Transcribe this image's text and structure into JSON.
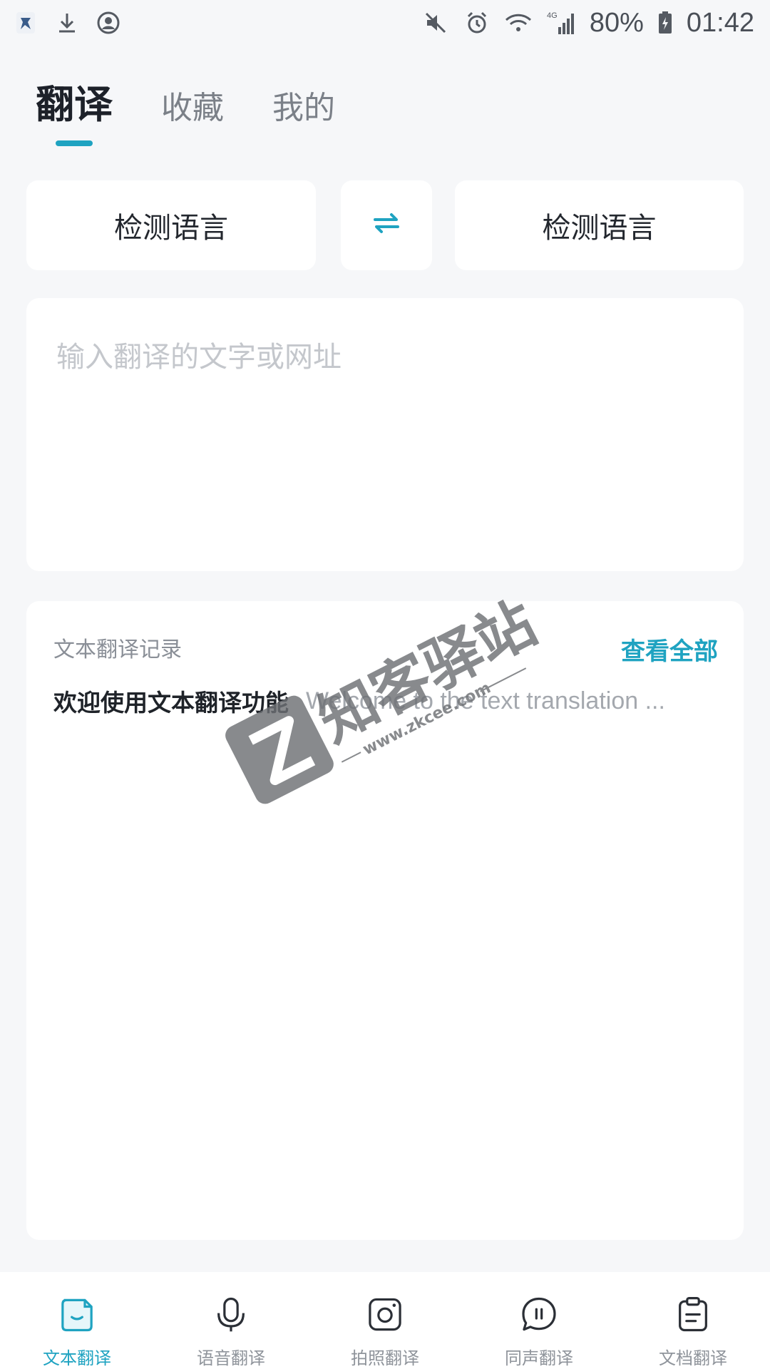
{
  "status_bar": {
    "battery": "80%",
    "time": "01:42",
    "network": "4G"
  },
  "tabs": [
    {
      "label": "翻译",
      "active": true
    },
    {
      "label": "收藏",
      "active": false
    },
    {
      "label": "我的",
      "active": false
    }
  ],
  "languages": {
    "source": "检测语言",
    "target": "检测语言"
  },
  "input": {
    "placeholder": "输入翻译的文字或网址",
    "value": ""
  },
  "history": {
    "title": "文本翻译记录",
    "view_all": "查看全部",
    "items": [
      {
        "source": "欢迎使用文本翻译功能",
        "translation": "Welcome to the text translation ..."
      }
    ]
  },
  "watermark": {
    "brand": "知客驿站",
    "domain": "www.zkcee.com"
  },
  "bottom_nav": [
    {
      "label": "文本翻译",
      "icon": "text-translate-icon",
      "active": true
    },
    {
      "label": "语音翻译",
      "icon": "microphone-icon",
      "active": false
    },
    {
      "label": "拍照翻译",
      "icon": "camera-icon",
      "active": false
    },
    {
      "label": "同声翻译",
      "icon": "chat-bubble-icon",
      "active": false
    },
    {
      "label": "文档翻译",
      "icon": "document-icon",
      "active": false
    }
  ],
  "colors": {
    "accent": "#1fa3c1",
    "background": "#f6f7f9",
    "card": "#ffffff"
  }
}
